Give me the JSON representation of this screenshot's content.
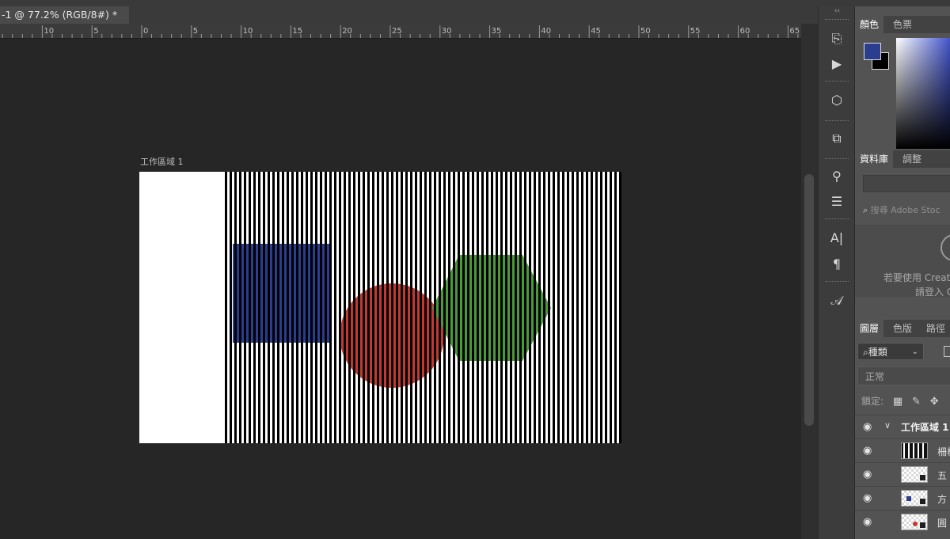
{
  "document": {
    "tab_title": "-1 @ 77.2% (RGB/8#) *"
  },
  "ruler": {
    "labels": [
      "10",
      "5",
      "0",
      "5",
      "10",
      "15",
      "20",
      "25",
      "30",
      "35",
      "40",
      "45",
      "50",
      "55",
      "60",
      "65"
    ]
  },
  "artboard": {
    "label": "工作區域 1",
    "colors": {
      "stripe": "#000000",
      "background": "#ffffff",
      "square": "#2b3d8f",
      "circle": "#c43a33",
      "hexagon": "#4a9a3a"
    }
  },
  "toolstrip": {
    "collapse_label": "‹‹",
    "tools": [
      {
        "name": "history",
        "glyph": "⎘"
      },
      {
        "name": "actions",
        "glyph": "▶"
      },
      {
        "name": "3d",
        "glyph": "⬡"
      },
      {
        "name": "clone-source",
        "glyph": "⧉"
      },
      {
        "name": "brush-presets",
        "glyph": "⚲"
      },
      {
        "name": "adjust",
        "glyph": "☰"
      },
      {
        "name": "character",
        "glyph": "A|"
      },
      {
        "name": "paragraph",
        "glyph": "¶"
      },
      {
        "name": "glyphs",
        "glyph": "𝒜"
      }
    ]
  },
  "panels": {
    "color": {
      "tabs": [
        "顏色",
        "色票"
      ],
      "foreground": "#2b3d8f",
      "background": "#000000"
    },
    "libraries": {
      "tabs": [
        "資料庫",
        "調整"
      ],
      "search_placeholder": "搜尋 Adobe Stoc",
      "message_line1": "若要使用 Creat",
      "message_line2": "請登入 C"
    },
    "layers": {
      "tabs": [
        "圖層",
        "色版",
        "路徑"
      ],
      "filter_label": "種類",
      "blend_mode": "正常",
      "lock_label": "鎖定:",
      "group": {
        "name": "工作區域 1"
      },
      "items": [
        {
          "name": "柵格",
          "thumb": "stripes"
        },
        {
          "name": "五",
          "thumb": "hexagon"
        },
        {
          "name": "方",
          "thumb": "square"
        },
        {
          "name": "圓",
          "thumb": "circle"
        }
      ]
    }
  }
}
